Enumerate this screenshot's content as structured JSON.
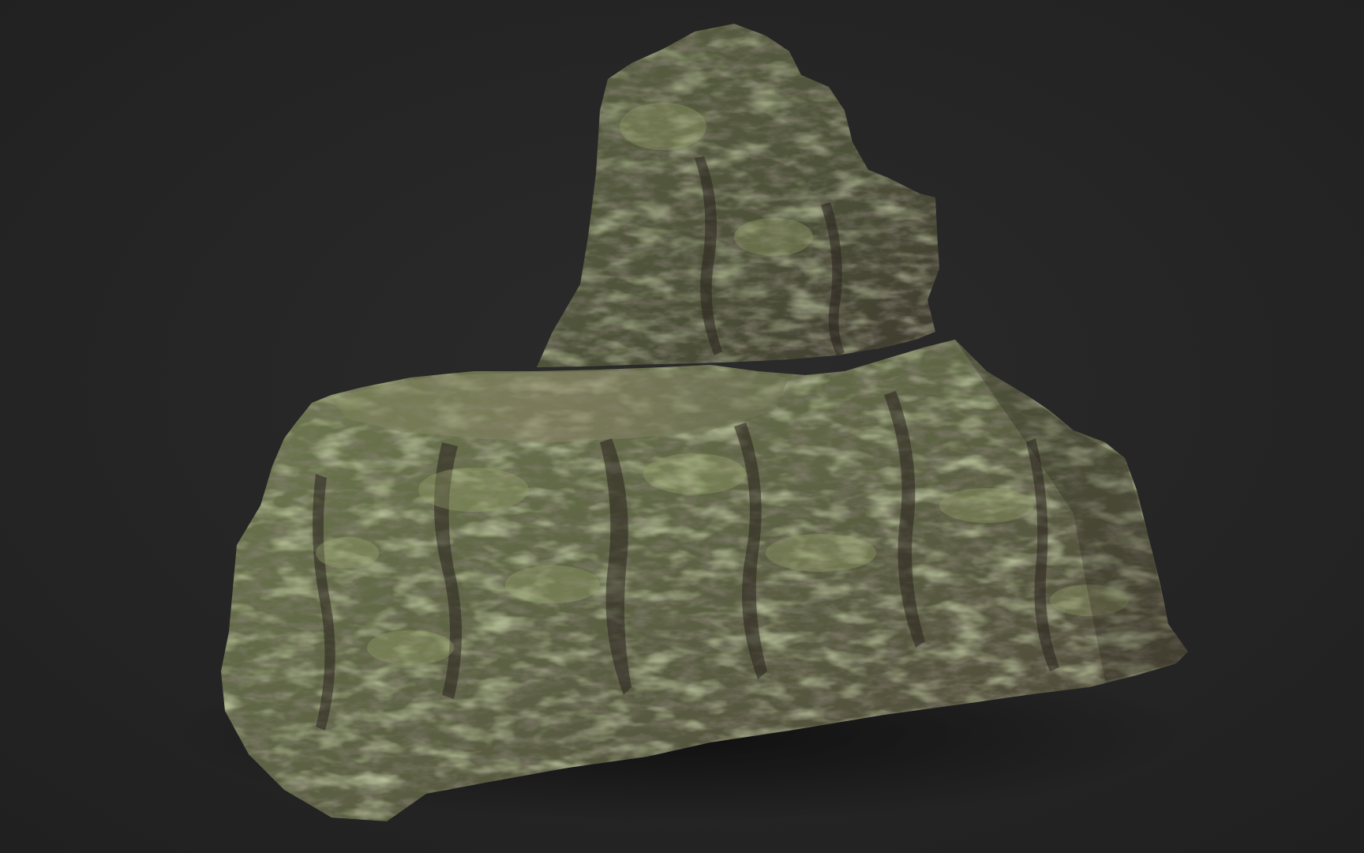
{
  "scene": {
    "subject": "rock-formation-render",
    "colors": {
      "background": "#262626",
      "moss": "#66724a",
      "moss_light": "#8e9a65",
      "rock_shadow": "#3a2f2a",
      "rock_pink": "#7a5f5a",
      "shadow": "#101010"
    }
  }
}
